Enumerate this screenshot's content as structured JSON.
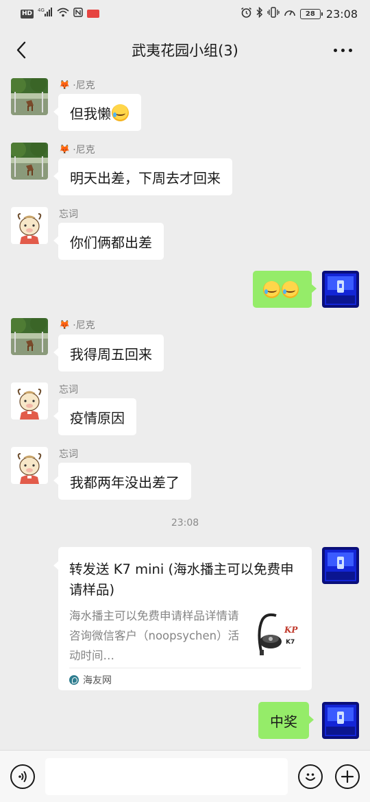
{
  "status_bar": {
    "left_chips": [
      "HD",
      "4G"
    ],
    "battery": "28",
    "time": "23:08"
  },
  "header": {
    "title": "武夷花园小组(3)"
  },
  "messages": [
    {
      "sender": "·尼克",
      "text": "但我懒"
    },
    {
      "sender": "·尼克",
      "text": "明天出差，下周去才回来"
    },
    {
      "sender": "忘词",
      "text": "你们俩都出差"
    },
    {
      "sender": "",
      "text": ""
    },
    {
      "sender": "·尼克",
      "text": "我得周五回来"
    },
    {
      "sender": "忘词",
      "text": "疫情原因"
    },
    {
      "sender": "忘词",
      "text": "我都两年没出差了"
    }
  ],
  "timestamp": "23:08",
  "share_card": {
    "title": "转发送 K7 mini (海水播主可以免费申请样品)",
    "description": "海水播主可以免费申请样品详情请咨询微信客户（noopsychen）活动时间…",
    "source": "海友网",
    "thumb_brand": "K7",
    "thumb_logo": "KP"
  },
  "last_message": {
    "text": "中奖"
  },
  "colors": {
    "background": "#ededed",
    "outgoing_bubble": "#95ec69",
    "incoming_bubble": "#ffffff"
  },
  "icons": {
    "back": "chevron-left-icon",
    "more": "more-dots-icon",
    "voice": "voice-icon",
    "emoji": "emoji-icon",
    "plus": "plus-icon"
  }
}
